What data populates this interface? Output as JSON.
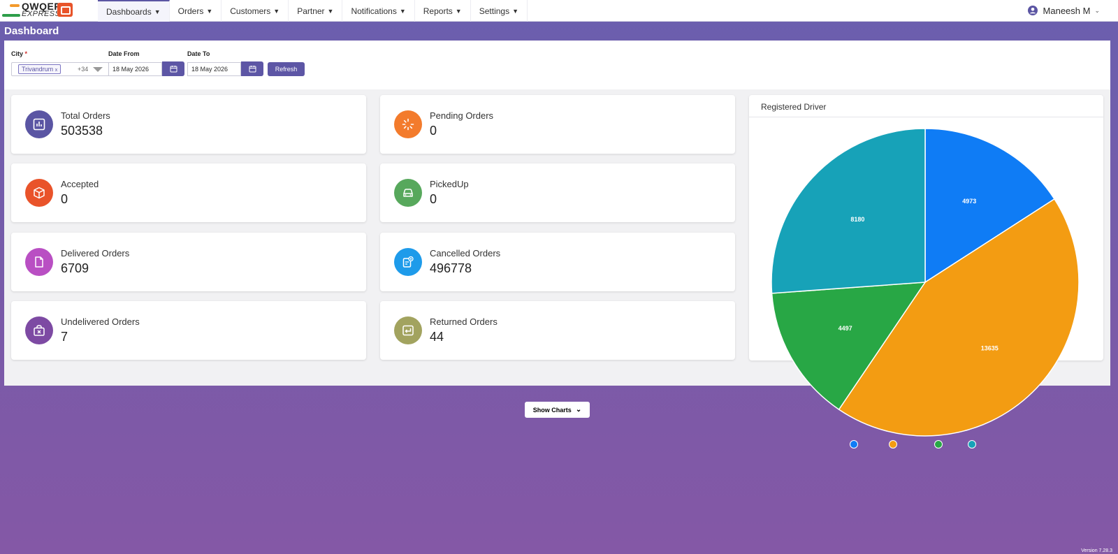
{
  "brand": {
    "name": "QWQER",
    "sub": "EXPRESS"
  },
  "nav": [
    {
      "label": "Dashboards"
    },
    {
      "label": "Orders"
    },
    {
      "label": "Customers"
    },
    {
      "label": "Partner"
    },
    {
      "label": "Notifications"
    },
    {
      "label": "Reports"
    },
    {
      "label": "Settings"
    }
  ],
  "user": {
    "name": "Maneesh M"
  },
  "page_title": "Dashboard",
  "filters": {
    "city_label": "City",
    "city_required_mark": "*",
    "city_selected": "Trivandrum",
    "city_chip_remove": "x",
    "city_more": "+34",
    "date_from_label": "Date From",
    "date_from_value": "18 May 2026",
    "date_to_label": "Date To",
    "date_to_value": "18 May 2026",
    "refresh_label": "Refresh"
  },
  "cards": [
    {
      "label": "Total Orders",
      "value": "503538",
      "color": "#5a55a3",
      "icon": "bar-chart-icon"
    },
    {
      "label": "Pending Orders",
      "value": "0",
      "color": "#f37b2c",
      "icon": "loader-icon"
    },
    {
      "label": "Accepted",
      "value": "0",
      "color": "#e9532a",
      "icon": "box-icon"
    },
    {
      "label": "PickedUp",
      "value": "0",
      "color": "#57a85c",
      "icon": "car-icon"
    },
    {
      "label": "Delivered Orders",
      "value": "6709",
      "color": "#b94fc3",
      "icon": "document-icon"
    },
    {
      "label": "Cancelled Orders",
      "value": "496778",
      "color": "#1e9bea",
      "icon": "cancel-form-icon"
    },
    {
      "label": "Undelivered Orders",
      "value": "7",
      "color": "#7d4aa3",
      "icon": "bag-x-icon"
    },
    {
      "label": "Returned Orders",
      "value": "44",
      "color": "#a2a35f",
      "icon": "return-icon"
    }
  ],
  "chart_data": {
    "type": "pie",
    "title": "Registered Driver",
    "values": [
      4973,
      13635,
      4497,
      8180
    ],
    "colors": [
      "#0f7cf5",
      "#f39c12",
      "#28a745",
      "#17a2b8"
    ]
  },
  "show_charts_label": "Show Charts",
  "version": "Version 7.28.3"
}
